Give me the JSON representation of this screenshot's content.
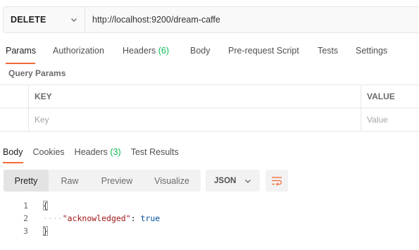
{
  "request": {
    "method": "DELETE",
    "url": "http://localhost:9200/dream-caffe"
  },
  "request_tabs": [
    {
      "label": "Params",
      "count": ""
    },
    {
      "label": "Authorization",
      "count": ""
    },
    {
      "label": "Headers",
      "count": "(6)"
    },
    {
      "label": "Body",
      "count": ""
    },
    {
      "label": "Pre-request Script",
      "count": ""
    },
    {
      "label": "Tests",
      "count": ""
    },
    {
      "label": "Settings",
      "count": ""
    }
  ],
  "query_params": {
    "title": "Query Params",
    "columns": {
      "key": "KEY",
      "value": "VALUE"
    },
    "placeholders": {
      "key": "Key",
      "value": "Value"
    }
  },
  "response_tabs": [
    {
      "label": "Body",
      "count": ""
    },
    {
      "label": "Cookies",
      "count": ""
    },
    {
      "label": "Headers",
      "count": "(3)"
    },
    {
      "label": "Test Results",
      "count": ""
    }
  ],
  "view_modes": [
    "Pretty",
    "Raw",
    "Preview",
    "Visualize"
  ],
  "format": "JSON",
  "code_lines": {
    "numbers": [
      "1",
      "2",
      "3"
    ],
    "open": "{",
    "dots": "····",
    "key": "\"acknowledged\"",
    "colon": ": ",
    "value": "true",
    "close": "}"
  },
  "colors": {
    "accent": "#f26b3a",
    "count_green": "#0cbb52",
    "json_key": "#a31515",
    "json_value": "#0451a5"
  },
  "icons": [
    "chevron-down-icon",
    "wrap-lines-icon"
  ]
}
